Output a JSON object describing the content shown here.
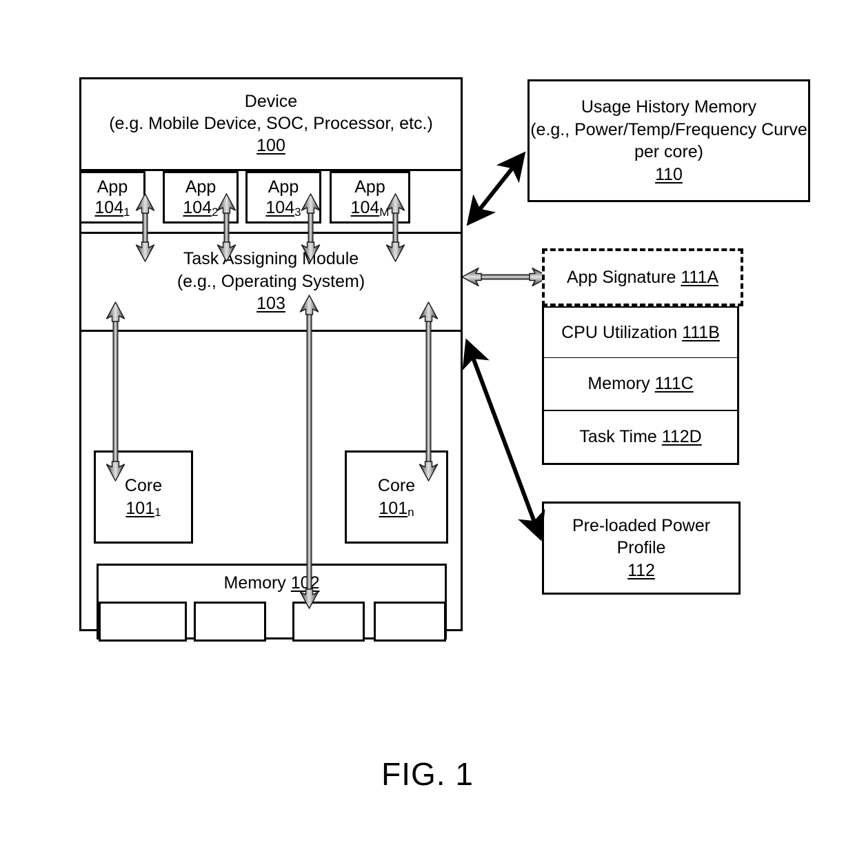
{
  "figure": {
    "caption": "FIG. 1"
  },
  "device": {
    "title_line1": "Device",
    "title_line2": "(e.g. Mobile Device, SOC, Processor, etc.)",
    "ref": "100",
    "apps": [
      {
        "label": "App",
        "ref": "104",
        "subscript": "1"
      },
      {
        "label": "App",
        "ref": "104",
        "subscript": "2"
      },
      {
        "label": "App",
        "ref": "104",
        "subscript": "3"
      },
      {
        "label": "App",
        "ref": "104",
        "subscript": "M"
      }
    ],
    "task_module": {
      "line1": "Task Assigning Module",
      "line2": "(e.g., Operating System)",
      "ref": "103"
    },
    "cores": [
      {
        "label": "Core",
        "ref": "101",
        "subscript": "1"
      },
      {
        "label": "Core",
        "ref": "101",
        "subscript": "n"
      }
    ],
    "memory": {
      "label": "Memory",
      "ref": "102",
      "banks": [
        "",
        "",
        "",
        ""
      ]
    }
  },
  "usage_history_memory": {
    "line1": "Usage History Memory",
    "line2": "(e.g., Power/Temp/Frequency Curve",
    "line3": "per core)",
    "ref": "110"
  },
  "profile_stack": {
    "app_signature": {
      "label": "App Signature",
      "ref": "111A"
    },
    "rows": [
      {
        "label": "CPU Utilization",
        "ref": "111B"
      },
      {
        "label": "Memory",
        "ref": "111C"
      },
      {
        "label": "Task Time",
        "ref": "112D"
      }
    ]
  },
  "preloaded_power_profile": {
    "line1": "Pre-loaded Power",
    "line2": "Profile",
    "ref": "112"
  },
  "colors": {
    "stroke": "#000000",
    "background": "#ffffff",
    "arrow_gray_light": "#c9c9c9",
    "arrow_gray_dark": "#4d4d4d"
  }
}
